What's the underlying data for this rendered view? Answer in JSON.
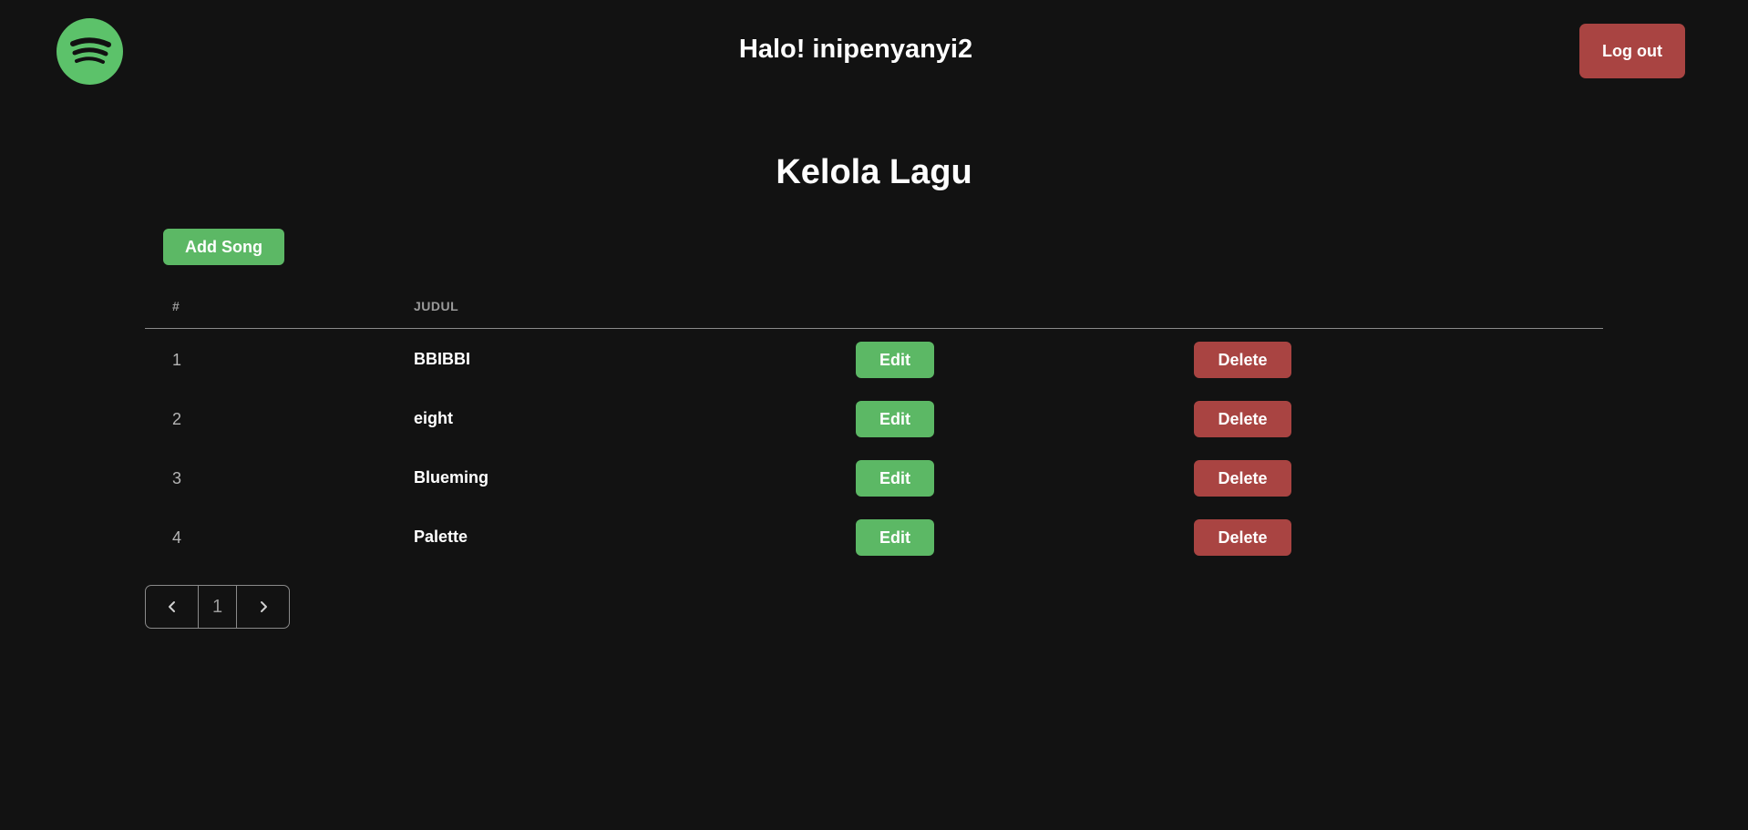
{
  "header": {
    "greeting": "Halo! inipenyanyi2",
    "logout_label": "Log out",
    "logo_icon": "spotify-logo-icon",
    "accent_color": "#5cc26a"
  },
  "main": {
    "title": "Kelola Lagu",
    "add_label": "Add Song"
  },
  "table": {
    "columns": [
      "#",
      "JUDUL"
    ],
    "rows": [
      {
        "num": "1",
        "title": "BBIBBI",
        "edit": "Edit",
        "delete": "Delete"
      },
      {
        "num": "2",
        "title": "eight",
        "edit": "Edit",
        "delete": "Delete"
      },
      {
        "num": "3",
        "title": "Blueming",
        "edit": "Edit",
        "delete": "Delete"
      },
      {
        "num": "4",
        "title": "Palette",
        "edit": "Edit",
        "delete": "Delete"
      }
    ]
  },
  "pagination": {
    "current_page": "1",
    "prev_icon": "chevron-left-icon",
    "next_icon": "chevron-right-icon"
  },
  "colors": {
    "background": "#121212",
    "green_button": "#5cb865",
    "red_button": "#a94442"
  }
}
